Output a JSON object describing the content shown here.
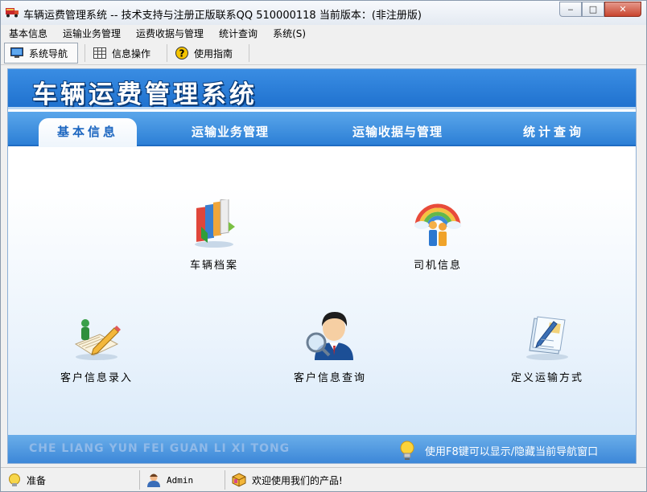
{
  "window": {
    "title": "车辆运费管理系统 -- 技术支持与注册正版联系QQ 510000118   当前版本：(非注册版)",
    "buttons": {
      "minimize": "‒",
      "maximize": "□",
      "close": "✕"
    }
  },
  "menu": [
    "基本信息",
    "运输业务管理",
    "运费收据与管理",
    "统计查询",
    "系统(S)"
  ],
  "toolbar": {
    "nav_label": "系统导航",
    "info_label": "信息操作",
    "guide_label": "使用指南"
  },
  "banner": {
    "title": "车辆运费管理系统"
  },
  "tabs": [
    "基本信息",
    "运输业务管理",
    "运输收据与管理",
    "统计查询"
  ],
  "modules": {
    "vehicle": "车辆档案",
    "driver": "司机信息",
    "customer_entry": "客户信息录入",
    "customer_query": "客户信息查询",
    "transport_mode": "定义运输方式"
  },
  "footer": {
    "pinyin": "CHE LIANG YUN FEI GUAN LI XI TONG",
    "hint": "使用F8键可以显示/隐藏当前导航窗口"
  },
  "status": {
    "state": "准备",
    "user": "Admin",
    "welcome": "欢迎使用我们的产品!"
  }
}
